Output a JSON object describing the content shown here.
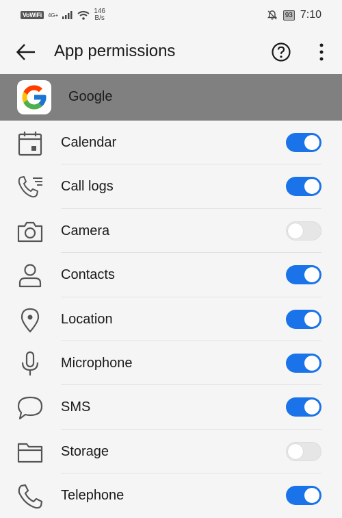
{
  "status_bar": {
    "vowifi": "VoWiFi",
    "network": "4G+",
    "speed_value": "146",
    "speed_unit": "B/s",
    "battery": "93",
    "time": "7:10"
  },
  "app_bar": {
    "title": "App permissions",
    "help_icon": "help-circle-icon",
    "more_icon": "more-vert-icon",
    "back_icon": "arrow-back-icon"
  },
  "app": {
    "name": "Google",
    "icon": "google-logo"
  },
  "colors": {
    "toggle_on": "#1a73e8",
    "toggle_off": "#e6e6e6",
    "band": "#808080"
  },
  "permissions": [
    {
      "label": "Calendar",
      "icon": "calendar-icon",
      "enabled": true
    },
    {
      "label": "Call logs",
      "icon": "call-log-icon",
      "enabled": true
    },
    {
      "label": "Camera",
      "icon": "camera-icon",
      "enabled": false
    },
    {
      "label": "Contacts",
      "icon": "person-icon",
      "enabled": true
    },
    {
      "label": "Location",
      "icon": "location-pin-icon",
      "enabled": true
    },
    {
      "label": "Microphone",
      "icon": "microphone-icon",
      "enabled": true
    },
    {
      "label": "SMS",
      "icon": "chat-bubble-icon",
      "enabled": true
    },
    {
      "label": "Storage",
      "icon": "folder-icon",
      "enabled": false
    },
    {
      "label": "Telephone",
      "icon": "phone-icon",
      "enabled": true
    }
  ]
}
